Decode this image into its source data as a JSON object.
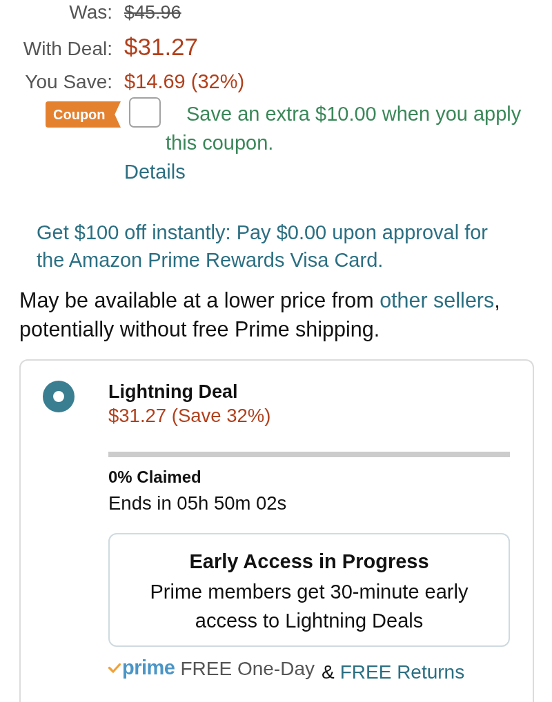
{
  "price_rows": [
    {
      "label": "Was:",
      "value": "$45.96",
      "kind": "strike"
    },
    {
      "label": "With Deal:",
      "value": "$31.27",
      "kind": "deal"
    },
    {
      "label": "You Save:",
      "value": "$14.69 (32%)",
      "kind": "savings"
    }
  ],
  "coupon": {
    "badge": "Coupon",
    "checked": false,
    "text": "Save an extra $10.00 when you apply this coupon.",
    "link": "Details"
  },
  "card_offer": {
    "text": "Get $100 off instantly: Pay $0.00 upon approval for the Amazon Prime Rewards Visa Card."
  },
  "availability": {
    "text_before": "May be available at a lower price from",
    "link": "other sellers",
    "text_after": ", potentially without free Prime shipping."
  },
  "deal": {
    "selected": true,
    "title": "Lightning Deal",
    "price": "$31.27 (Save 32%)",
    "claimed_bar": {
      "level": 0
    },
    "claimed": "0% Claimed",
    "ends": "Ends in 05h 50m 02s",
    "early_access": {
      "title": "Early Access in Progress",
      "text": "Prime members get 30-minute early access to Lightning Deals"
    },
    "delivery": {
      "prime": "prime",
      "shipping": "FREE One-Day",
      "separator": "&",
      "returns": "FREE Returns"
    }
  }
}
